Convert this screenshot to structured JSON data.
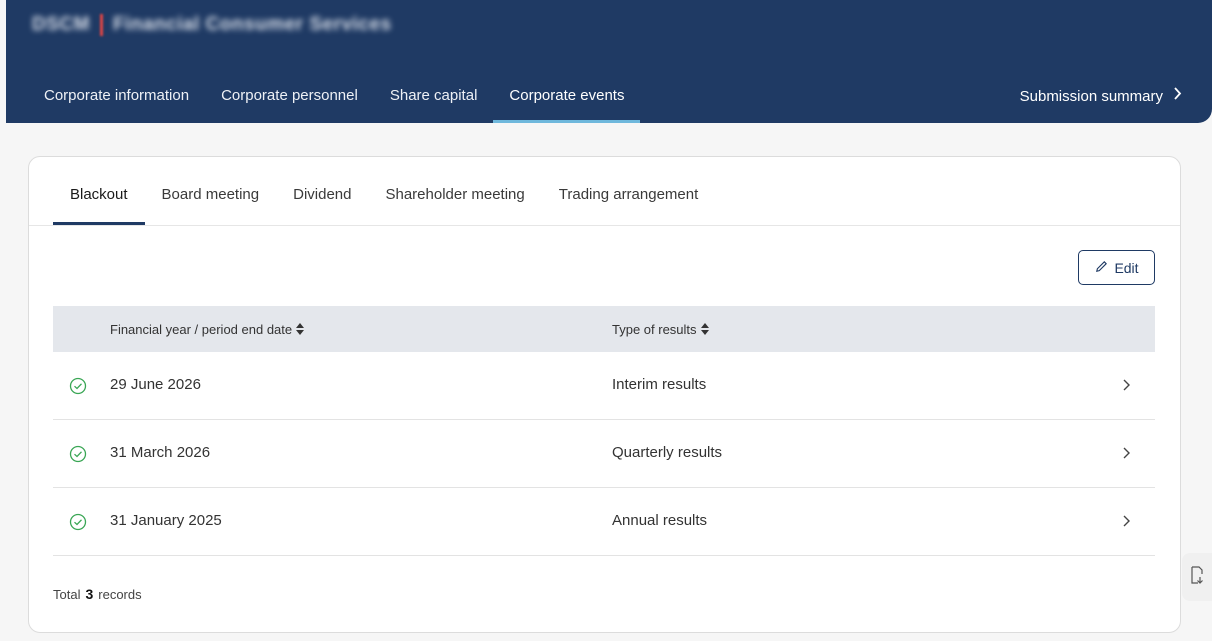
{
  "header": {
    "title_code": "DSCM",
    "title_name": "Financial Consumer Services",
    "nav": [
      "Corporate information",
      "Corporate personnel",
      "Share capital",
      "Corporate events"
    ],
    "active_nav": "Corporate events",
    "summary_link": "Submission summary"
  },
  "subtabs": [
    "Blackout",
    "Board meeting",
    "Dividend",
    "Shareholder meeting",
    "Trading arrangement"
  ],
  "active_subtab": "Blackout",
  "edit_label": "Edit",
  "table": {
    "columns": [
      "Financial year / period end date",
      "Type of results"
    ],
    "rows": [
      {
        "date": "29 June 2026",
        "type": "Interim results"
      },
      {
        "date": "31 March 2026",
        "type": "Quarterly results"
      },
      {
        "date": "31 January 2025",
        "type": "Annual results"
      }
    ]
  },
  "footer": {
    "total_label": "Total",
    "count": "3",
    "records_label": "records"
  },
  "colors": {
    "header_bg": "#1f3a64",
    "nav_active_underline": "#6fb8dc",
    "status_ok": "#3aa655"
  },
  "icons": [
    "pencil-icon",
    "check-circle-icon",
    "chevron-right-icon",
    "sort-icon",
    "export-icon"
  ]
}
